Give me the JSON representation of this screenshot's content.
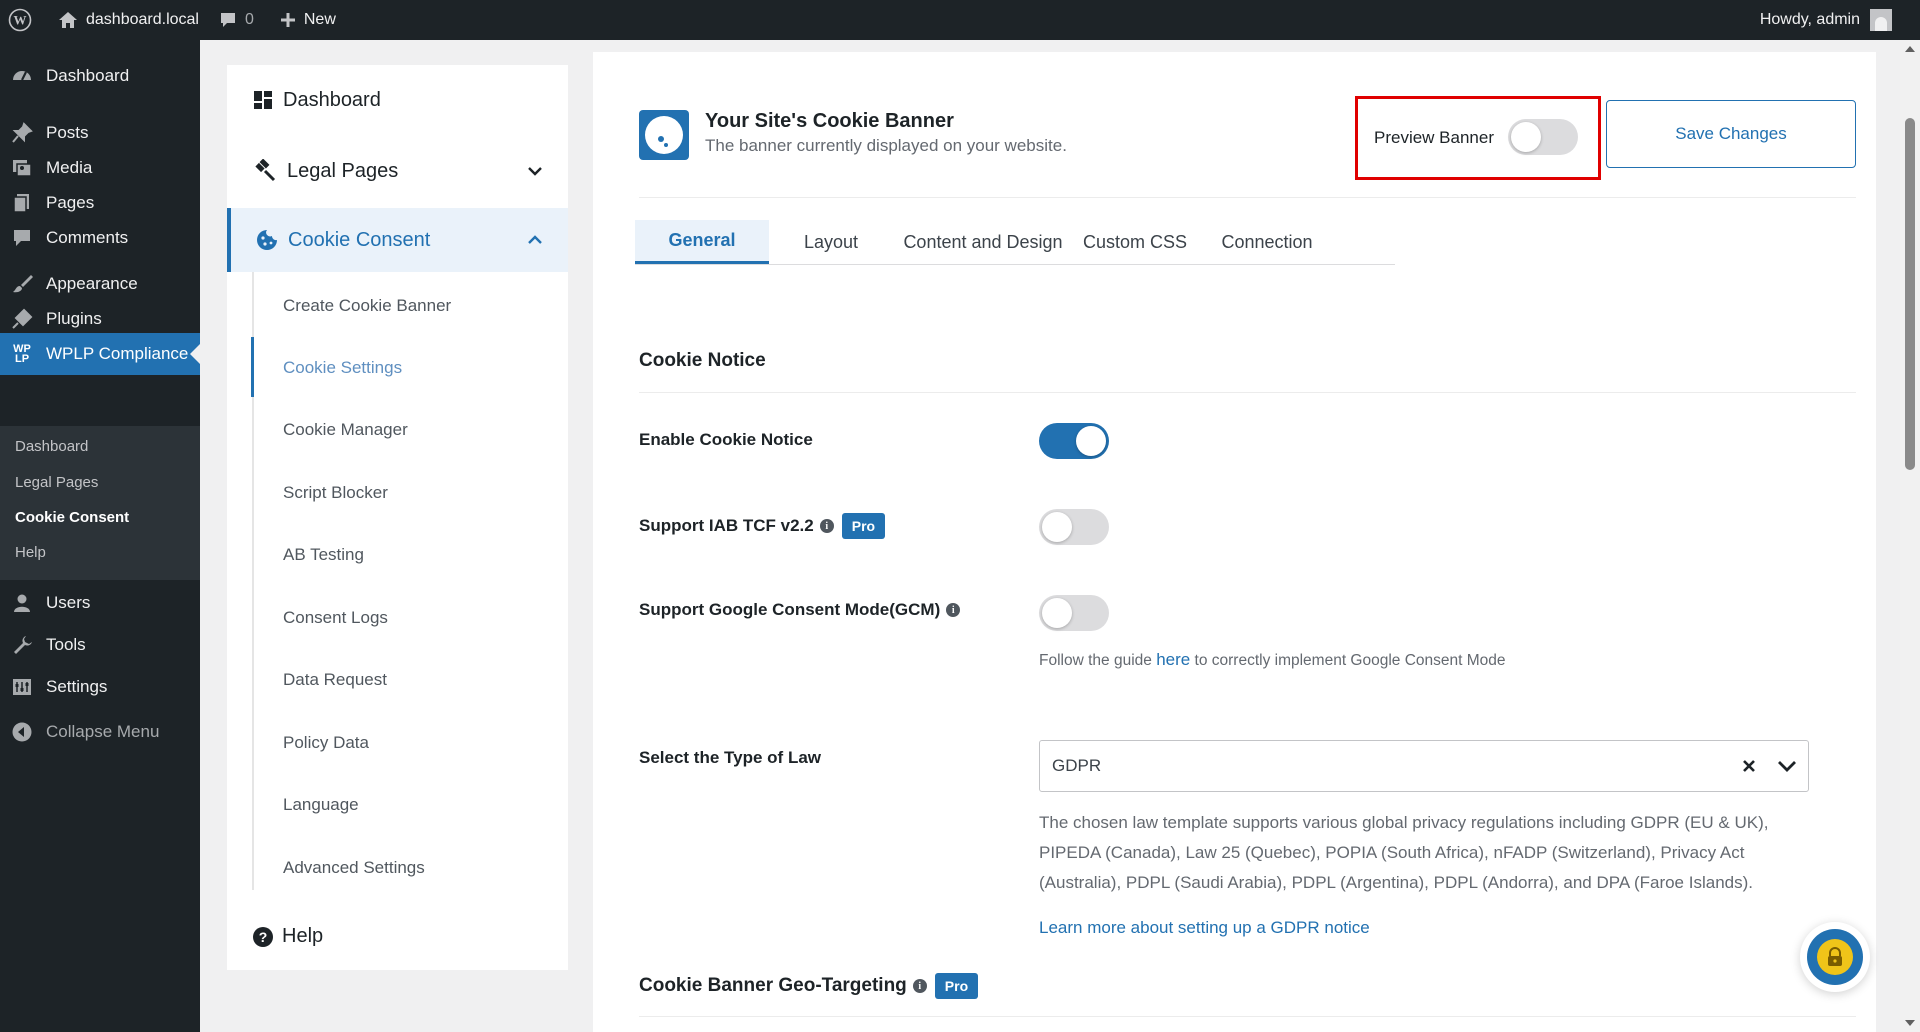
{
  "admin_bar": {
    "site_name": "dashboard.local",
    "comments_count": "0",
    "new_label": "New",
    "greeting": "Howdy, admin"
  },
  "admin_menu": {
    "items": [
      {
        "label": "Dashboard",
        "icon": "dashboard-icon"
      },
      {
        "label": "Posts",
        "icon": "pin-icon"
      },
      {
        "label": "Media",
        "icon": "media-icon"
      },
      {
        "label": "Pages",
        "icon": "pages-icon"
      },
      {
        "label": "Comments",
        "icon": "comment-icon"
      },
      {
        "label": "Appearance",
        "icon": "brush-icon"
      },
      {
        "label": "Plugins",
        "icon": "plugin-icon"
      },
      {
        "label": "WPLP Compliance",
        "icon": "wplp-icon"
      },
      {
        "label": "Users",
        "icon": "user-icon"
      },
      {
        "label": "Tools",
        "icon": "wrench-icon"
      },
      {
        "label": "Settings",
        "icon": "settings-icon"
      },
      {
        "label": "Collapse Menu",
        "icon": "collapse-icon"
      }
    ],
    "submenu": [
      "Dashboard",
      "Legal Pages",
      "Cookie Consent",
      "Help"
    ],
    "wplp_logo_text": "WP LP"
  },
  "plugin_nav": {
    "dashboard": "Dashboard",
    "legal_pages": "Legal Pages",
    "cookie_consent": "Cookie Consent",
    "subitems": [
      "Create Cookie Banner",
      "Cookie Settings",
      "Cookie Manager",
      "Script Blocker",
      "AB Testing",
      "Consent Logs",
      "Data Request",
      "Policy Data",
      "Language",
      "Advanced Settings"
    ],
    "help": "Help"
  },
  "header": {
    "title": "Your Site's Cookie Banner",
    "subtitle": "The banner currently displayed on your website.",
    "preview_label": "Preview Banner",
    "preview_on": false,
    "save_label": "Save Changes"
  },
  "tabs": [
    "General",
    "Layout",
    "Content and Design",
    "Custom CSS",
    "Connection"
  ],
  "cookie_notice": {
    "section_title": "Cookie Notice",
    "enable_label": "Enable Cookie Notice",
    "enable_on": true,
    "iab_label": "Support IAB TCF v2.2",
    "iab_on": false,
    "pro_badge": "Pro",
    "gcm_label": "Support Google Consent Mode(GCM)",
    "gcm_on": false,
    "gcm_help_before": "Follow the guide ",
    "gcm_help_link": "here",
    "gcm_help_after": " to correctly implement Google Consent Mode",
    "law_label": "Select the Type of Law",
    "law_value": "GDPR",
    "law_description": "The chosen law template supports various global privacy regulations including GDPR (EU & UK), PIPEDA (Canada), Law 25 (Quebec), POPIA (South Africa), nFADP (Switzerland), Privacy Act (Australia), PDPL (Saudi Arabia), PDPL (Argentina), PDPL (Andorra), and DPA (Faroe Islands).",
    "learn_more": "Learn more about setting up a GDPR notice"
  },
  "geo_targeting": {
    "title": "Cookie Banner Geo-Targeting",
    "pro_badge": "Pro"
  },
  "colors": {
    "accent": "#2271b1",
    "admin_bar": "#1d2327",
    "highlight": "#e00000"
  }
}
